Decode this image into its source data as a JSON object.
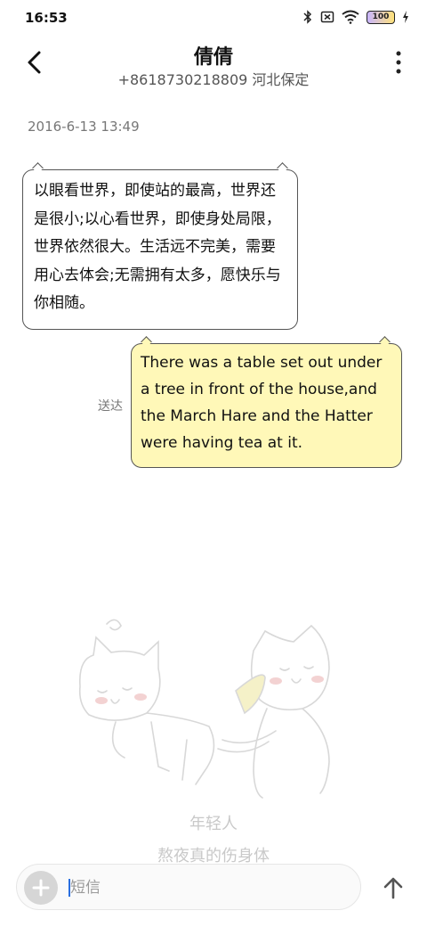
{
  "status_bar": {
    "time": "16:53",
    "battery_level": "100",
    "icons": [
      "bluetooth-icon",
      "sim-off-icon",
      "wifi-icon",
      "battery-icon",
      "charging-icon"
    ]
  },
  "header": {
    "contact_name": "倩倩",
    "phone_location": "+8618730218809 河北保定"
  },
  "conversation": {
    "timestamp": "2016-6-13 13:49",
    "messages": [
      {
        "direction": "incoming",
        "text": "以眼看世界，即使站的最高，世界还是很小;以心看世界，即使身处局限，世界依然很大。生活远不完美，需要用心去体会;无需拥有太多，愿快乐与你相随。"
      },
      {
        "direction": "outgoing",
        "status": "送达",
        "text": "There was a table set out under a tree in front of the house,and the March Hare and the Hatter were having tea at it."
      }
    ]
  },
  "background": {
    "tagline_1": "年轻人",
    "tagline_2": "熬夜真的伤身体"
  },
  "composer": {
    "placeholder": "短信",
    "value": ""
  },
  "colors": {
    "incoming_bubble": "#ffffff",
    "outgoing_bubble": "#fff8b8",
    "bubble_border": "#555555",
    "caret": "#2a6fe0"
  }
}
